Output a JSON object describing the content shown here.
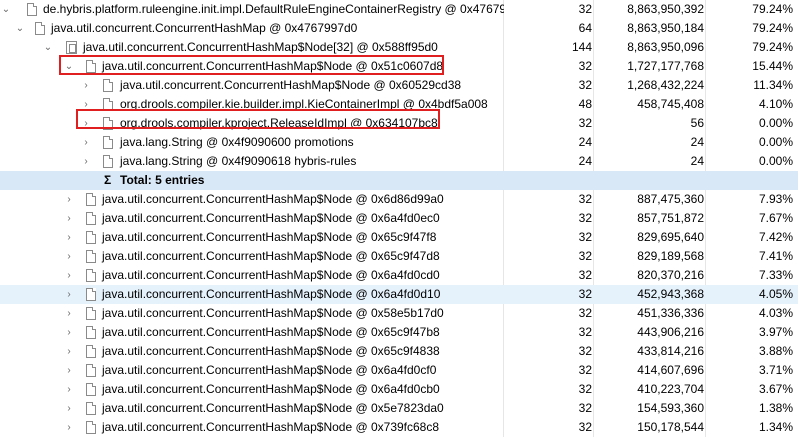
{
  "rows": [
    {
      "label": "de.hybris.platform.ruleengine.init.impl.DefaultRuleEngineContainerRegistry @ 0x47679",
      "c1": "32",
      "c2": "8,863,950,392",
      "c3": "79.24%",
      "icon": "file",
      "chevron": "down"
    },
    {
      "label": "java.util.concurrent.ConcurrentHashMap @ 0x4767997d0",
      "c1": "64",
      "c2": "8,863,950,184",
      "c3": "79.24%",
      "icon": "file",
      "chevron": "down"
    },
    {
      "label": "java.util.concurrent.ConcurrentHashMap$Node[32] @ 0x588ff95d0",
      "c1": "144",
      "c2": "8,863,950,096",
      "c3": "79.24%",
      "icon": "array",
      "chevron": "down"
    },
    {
      "label": "java.util.concurrent.ConcurrentHashMap$Node @ 0x51c0607d8",
      "c1": "32",
      "c2": "1,727,177,768",
      "c3": "15.44%",
      "icon": "file",
      "chevron": "down"
    },
    {
      "label": "java.util.concurrent.ConcurrentHashMap$Node @ 0x60529cd38",
      "c1": "32",
      "c2": "1,268,432,224",
      "c3": "11.34%",
      "icon": "file",
      "chevron": "right"
    },
    {
      "label": "org.drools.compiler.kie.builder.impl.KieContainerImpl @ 0x4bdf5a008",
      "c1": "48",
      "c2": "458,745,408",
      "c3": "4.10%",
      "icon": "file",
      "chevron": "right"
    },
    {
      "label": "org.drools.compiler.kproject.ReleaseIdImpl @ 0x634107bc8",
      "c1": "32",
      "c2": "56",
      "c3": "0.00%",
      "icon": "file",
      "chevron": "right"
    },
    {
      "label": "java.lang.String @ 0x4f9090600  promotions",
      "c1": "24",
      "c2": "24",
      "c3": "0.00%",
      "icon": "file",
      "chevron": "right"
    },
    {
      "label": "java.lang.String @ 0x4f9090618  hybris-rules",
      "c1": "24",
      "c2": "24",
      "c3": "0.00%",
      "icon": "file",
      "chevron": "right"
    },
    {
      "label": "Total: 5 entries",
      "c1": "",
      "c2": "",
      "c3": "",
      "icon": "sigma",
      "chevron": "none"
    },
    {
      "label": "java.util.concurrent.ConcurrentHashMap$Node @ 0x6d86d99a0",
      "c1": "32",
      "c2": "887,475,360",
      "c3": "7.93%",
      "icon": "file",
      "chevron": "right"
    },
    {
      "label": "java.util.concurrent.ConcurrentHashMap$Node @ 0x6a4fd0ec0",
      "c1": "32",
      "c2": "857,751,872",
      "c3": "7.67%",
      "icon": "file",
      "chevron": "right"
    },
    {
      "label": "java.util.concurrent.ConcurrentHashMap$Node @ 0x65c9f47f8",
      "c1": "32",
      "c2": "829,695,640",
      "c3": "7.42%",
      "icon": "file",
      "chevron": "right"
    },
    {
      "label": "java.util.concurrent.ConcurrentHashMap$Node @ 0x65c9f47d8",
      "c1": "32",
      "c2": "829,189,568",
      "c3": "7.41%",
      "icon": "file",
      "chevron": "right"
    },
    {
      "label": "java.util.concurrent.ConcurrentHashMap$Node @ 0x6a4fd0cd0",
      "c1": "32",
      "c2": "820,370,216",
      "c3": "7.33%",
      "icon": "file",
      "chevron": "right"
    },
    {
      "label": "java.util.concurrent.ConcurrentHashMap$Node @ 0x6a4fd0d10",
      "c1": "32",
      "c2": "452,943,368",
      "c3": "4.05%",
      "icon": "file",
      "chevron": "right"
    },
    {
      "label": "java.util.concurrent.ConcurrentHashMap$Node @ 0x58e5b17d0",
      "c1": "32",
      "c2": "451,336,336",
      "c3": "4.03%",
      "icon": "file",
      "chevron": "right"
    },
    {
      "label": "java.util.concurrent.ConcurrentHashMap$Node @ 0x65c9f47b8",
      "c1": "32",
      "c2": "443,906,216",
      "c3": "3.97%",
      "icon": "file",
      "chevron": "right"
    },
    {
      "label": "java.util.concurrent.ConcurrentHashMap$Node @ 0x65c9f4838",
      "c1": "32",
      "c2": "433,814,216",
      "c3": "3.88%",
      "icon": "file",
      "chevron": "right"
    },
    {
      "label": "java.util.concurrent.ConcurrentHashMap$Node @ 0x6a4fd0cf0",
      "c1": "32",
      "c2": "414,607,696",
      "c3": "3.71%",
      "icon": "file",
      "chevron": "right"
    },
    {
      "label": "java.util.concurrent.ConcurrentHashMap$Node @ 0x6a4fd0cb0",
      "c1": "32",
      "c2": "410,223,704",
      "c3": "3.67%",
      "icon": "file",
      "chevron": "right"
    },
    {
      "label": "java.util.concurrent.ConcurrentHashMap$Node @ 0x5e7823da0",
      "c1": "32",
      "c2": "154,593,360",
      "c3": "1.38%",
      "icon": "file",
      "chevron": "right"
    },
    {
      "label": "java.util.concurrent.ConcurrentHashMap$Node @ 0x739fc68c8",
      "c1": "32",
      "c2": "150,178,544",
      "c3": "1.34%",
      "icon": "file",
      "chevron": "right"
    }
  ],
  "colors": {
    "highlight_border": "#e02020",
    "total_row_bg": "#d9e8f7",
    "selected_row_bg": "#e5f1fb"
  }
}
